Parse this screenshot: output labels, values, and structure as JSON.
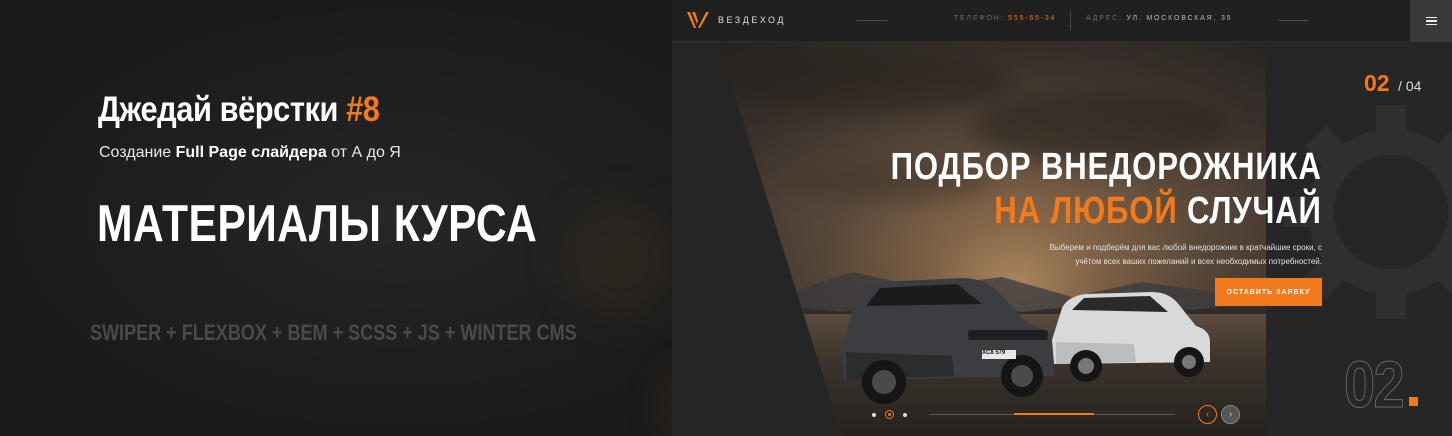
{
  "promo": {
    "title": "Джедай вёрстки",
    "title_num": "#8",
    "subtitle_pre": "Создание",
    "subtitle_bold": "Full Page слайдера",
    "subtitle_post": "от А до Я",
    "heading": "МАТЕРИАЛЫ КУРСА",
    "tech": "SWIPER + FLEXBOX + BEM + SCSS + JS + WINTER CMS"
  },
  "site": {
    "logo_text": "ВЕЗДЕХОД",
    "phone_label": "ТЕЛЕФОН:",
    "phone_value": "555-65-34",
    "address_label": "АДРЕС:",
    "address_value": "УЛ. МОСКОВСКАЯ, 35",
    "menu_icon": "hamburger-icon",
    "slide_current": "02",
    "slide_total": "/ 04",
    "hero_line1": "ПОДБОР ВНЕДОРОЖНИКА",
    "hero_line2_accent": "НА ЛЮБОЙ",
    "hero_line2_rest": "СЛУЧАЙ",
    "hero_desc": "Выберем и подберём для вас любой внедорожник в кратчайшие сроки, с учётом всех ваших пожеланий и всех необходимых потребностей.",
    "cta_label": "ОСТАВИТЬ ЗАЯВКУ",
    "big_number": "02",
    "car_plate": "XC8 579",
    "active_dot": 2,
    "prev_arrow": "‹",
    "next_arrow": "›"
  },
  "colors": {
    "accent": "#f27a1a",
    "background": "#1d1d1d",
    "header": "#202020"
  }
}
